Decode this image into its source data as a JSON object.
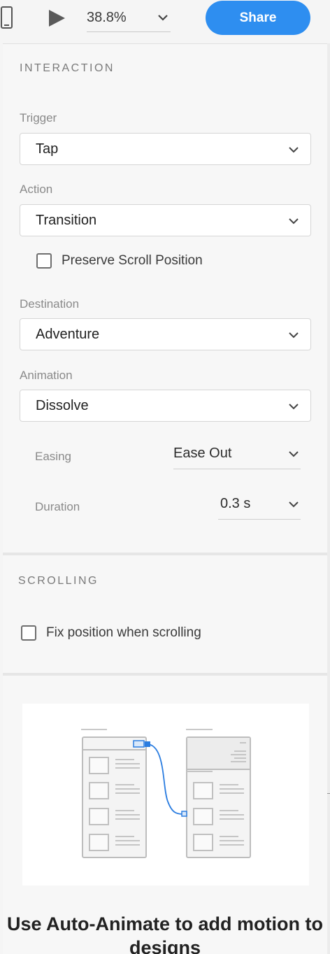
{
  "toolbar": {
    "device_icon": "mobile-device-icon",
    "play_icon": "play-icon",
    "zoom": "38.8%",
    "share_label": "Share"
  },
  "interaction": {
    "title": "INTERACTION",
    "trigger": {
      "label": "Trigger",
      "value": "Tap"
    },
    "action": {
      "label": "Action",
      "value": "Transition"
    },
    "preserve_scroll": {
      "label": "Preserve Scroll Position",
      "checked": false
    },
    "destination": {
      "label": "Destination",
      "value": "Adventure"
    },
    "animation": {
      "label": "Animation",
      "value": "Dissolve"
    },
    "easing": {
      "label": "Easing",
      "value": "Ease Out"
    },
    "duration": {
      "label": "Duration",
      "value": "0.3 s"
    }
  },
  "scrolling": {
    "title": "SCROLLING",
    "fix_position": {
      "label": "Fix position when scrolling",
      "checked": false
    }
  },
  "promo": {
    "title": "Use Auto-Animate to add motion to designs"
  },
  "colors": {
    "accent": "#2e8ef0",
    "panel_bg": "#f7f7f7",
    "wire_blue": "#2b7de0"
  }
}
